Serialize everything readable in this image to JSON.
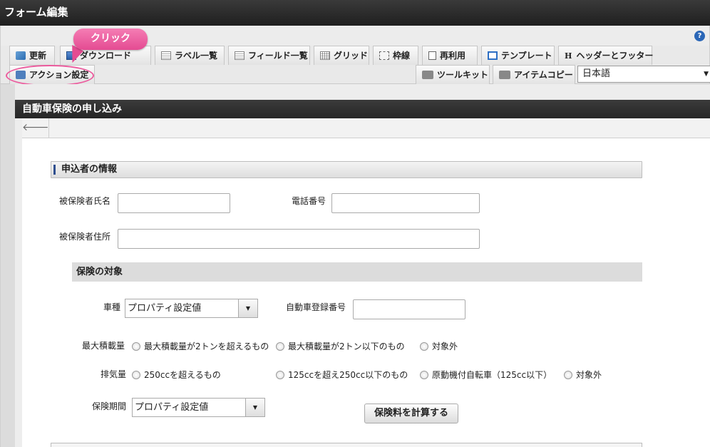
{
  "window": {
    "title": "フォーム編集"
  },
  "help": {
    "icon": "help-icon",
    "glyph": "?"
  },
  "toolbar": {
    "tabs_row1": [
      {
        "label": "更新",
        "icon": "refresh-icon"
      },
      {
        "label": "ダウンロード",
        "icon": "download-icon"
      },
      {
        "label": "ラベル一覧",
        "icon": "list-icon"
      },
      {
        "label": "フィールド一覧",
        "icon": "list-icon"
      },
      {
        "label": "グリッド",
        "icon": "grid-icon"
      },
      {
        "label": "枠線",
        "icon": "frame-icon"
      },
      {
        "label": "再利用",
        "icon": "reuse-icon"
      },
      {
        "label": "テンプレート",
        "icon": "template-icon"
      },
      {
        "label": "ヘッダーとフッター",
        "icon": "header-footer-icon"
      }
    ],
    "tabs_row2": [
      {
        "label": "アクション設定",
        "icon": "action-icon"
      },
      {
        "label": "ツールキット",
        "icon": "toolkit-icon"
      },
      {
        "label": "アイテムコピー",
        "icon": "toolkit-icon"
      }
    ],
    "language": {
      "value": "日本語",
      "arrow": "▼"
    }
  },
  "annotation": {
    "callout": "クリック",
    "color": "#e44b92"
  },
  "form": {
    "title": "自動車保険の申し込み",
    "back_glyph": "🡐",
    "section1": {
      "title": "申込者の情報"
    },
    "fields": {
      "insured_name": "被保険者氏名",
      "phone": "電話番号",
      "address": "被保険者住所"
    },
    "section2": {
      "title": "保険の対象"
    },
    "vehicle": {
      "type_label": "車種",
      "type_value": "プロパティ設定値",
      "reg_label": "自動車登録番号",
      "max_load_label": "最大積載量",
      "max_load_options": [
        "最大積載量が2トンを超えるもの",
        "最大積載量が2トン以下のもの",
        "対象外"
      ],
      "displacement_label": "排気量",
      "displacement_options": [
        "250ccを超えるもの",
        "125ccを超え250cc以下のもの",
        "原動機付自転車（125cc以下）",
        "対象外"
      ],
      "period_label": "保険期間",
      "period_value": "プロパティ設定値",
      "calc_button": "保険料を計算する"
    },
    "dropdown_arrow": "▼"
  }
}
